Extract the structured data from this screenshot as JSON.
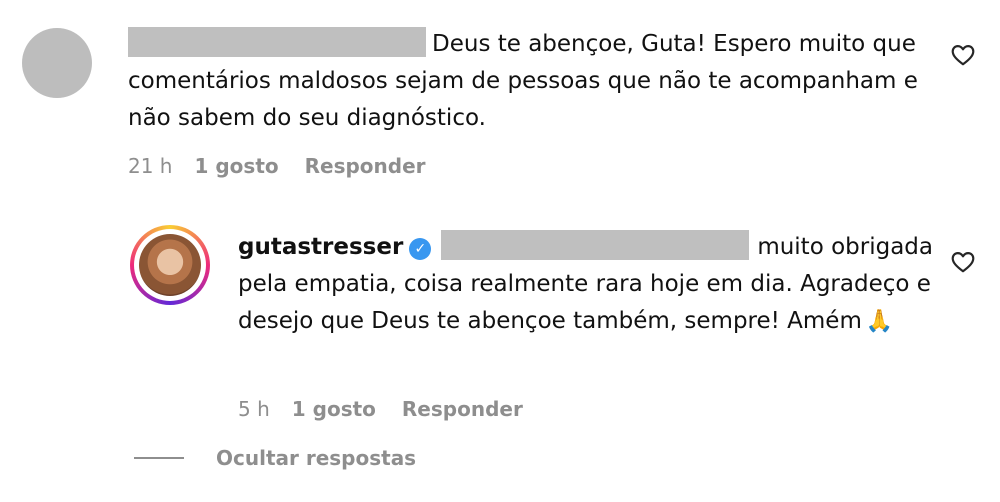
{
  "comment": {
    "text": "Deus te abençoe, Guta! Espero muito que comentários maldosos sejam de pessoas que não te acompanham e não sabem do seu diagnóstico.",
    "time": "21 h",
    "likes": "1 gosto",
    "reply_label": "Responder"
  },
  "reply": {
    "username": "gutastresser",
    "text_part1": "muito obrigada pela empatia, coisa realmente rara hoje em dia. Agradeço e desejo que Deus te abençoe também, sempre! Amém",
    "emoji": "🙏",
    "time": "5 h",
    "likes": "1 gosto",
    "reply_label": "Responder"
  },
  "hide_replies_label": "Ocultar respostas",
  "colors": {
    "secondary_text": "#8e8e8e",
    "verified_badge": "#3897f0",
    "redaction": "#bfbfbf"
  },
  "icons": {
    "like": "heart-outline-icon",
    "verified": "verified-badge-icon"
  }
}
